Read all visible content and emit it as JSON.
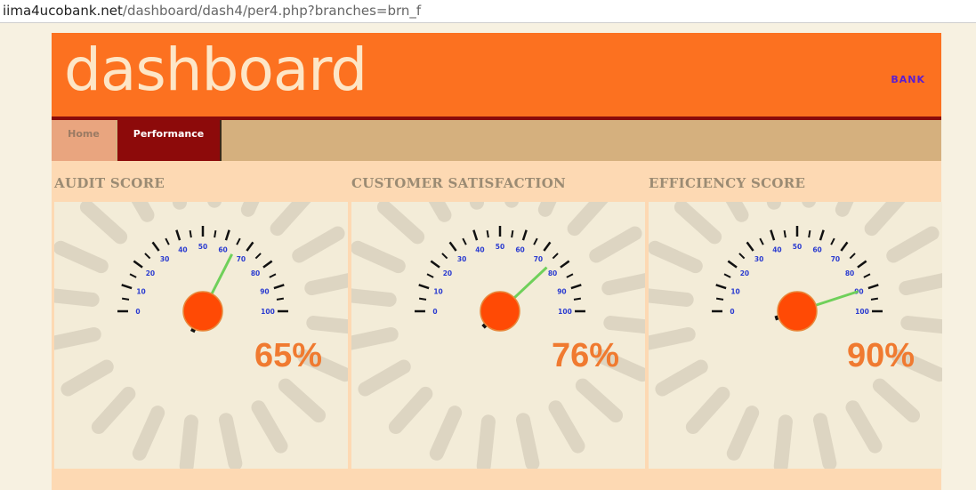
{
  "browser": {
    "url_host": "iima4ucobank.net",
    "url_path": "/dashboard/dash4/per4.php?branches=brn_f"
  },
  "header": {
    "title": "dashboard",
    "bank_link": "BANK"
  },
  "nav": {
    "tabs": [
      {
        "label": "Home",
        "active": false
      },
      {
        "label": "Performance",
        "active": true
      }
    ]
  },
  "colors": {
    "header_bg": "#fc7120",
    "active_tab_bg": "#8d0a0a",
    "gauge_hub": "#ff4a05",
    "needle": "#6fd05a",
    "percent_text": "#f07a30",
    "tick_label": "#2a3bd0"
  },
  "gauges": [
    {
      "title": "AUDIT SCORE",
      "value": 65,
      "display": "65%"
    },
    {
      "title": "CUSTOMER SATISFACTION",
      "value": 76,
      "display": "76%"
    },
    {
      "title": "EFFICIENCY SCORE",
      "value": 90,
      "display": "90%"
    }
  ],
  "gauge_scale": {
    "min": 0,
    "max": 100,
    "tick_labels": [
      "0",
      "10",
      "20",
      "30",
      "40",
      "50",
      "60",
      "70",
      "80",
      "90",
      "100"
    ]
  }
}
